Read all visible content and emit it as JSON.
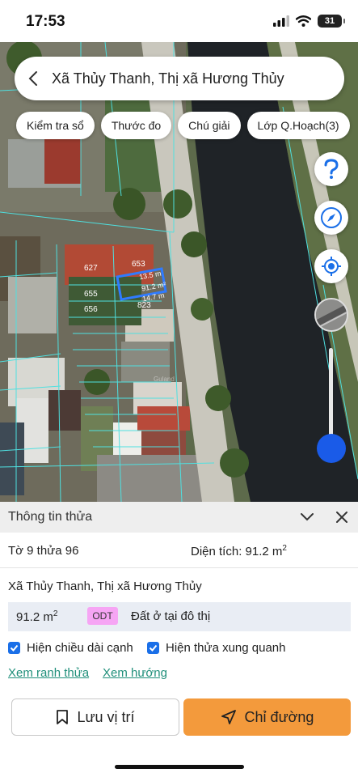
{
  "status": {
    "time": "17:53",
    "battery": "31"
  },
  "search": {
    "title": "Xã Thủy Thanh, Thị xã Hương Thủy"
  },
  "chips": [
    "Kiểm tra sổ",
    "Thước đo",
    "Chú giải",
    "Lớp Q.Hoạch(3)"
  ],
  "map_labels": {
    "parcel_627": "627",
    "parcel_653": "653",
    "parcel_655": "655",
    "parcel_656": "656",
    "parcel_823": "823",
    "dim_top": "13.5 m",
    "dim_area": "91.2 m²",
    "dim_bottom": "14.7 m",
    "watermark": "Guland"
  },
  "fab_icons": [
    "help-icon",
    "compass-icon",
    "locate-icon"
  ],
  "colors": {
    "accent": "#1a5be8",
    "direction_button": "#f39a3c",
    "link": "#1f8f7a",
    "odt_badge": "#f6a5f4",
    "parcel_outline": "#4fe0e0",
    "selected_parcel": "#2f7bff"
  },
  "panel": {
    "title": "Thông tin thửa",
    "parcel_id": "Tờ 9 thửa 96",
    "area_text": "Diện tích: 91.2 m",
    "area_sup": "2",
    "address": "Xã Thủy Thanh, Thị xã Hương Thủy",
    "land_area": "91.2 m",
    "land_area_sup": "2",
    "land_code": "ODT",
    "land_type": "Đất ở tại đô thị",
    "check_edges": "Hiện chiều dài cạnh",
    "check_neighbors": "Hiện thửa xung quanh",
    "link_boundary": "Xem ranh thửa",
    "link_direction": "Xem hướng",
    "save_label": "Lưu vị trí",
    "direction_label": "Chỉ đường"
  }
}
